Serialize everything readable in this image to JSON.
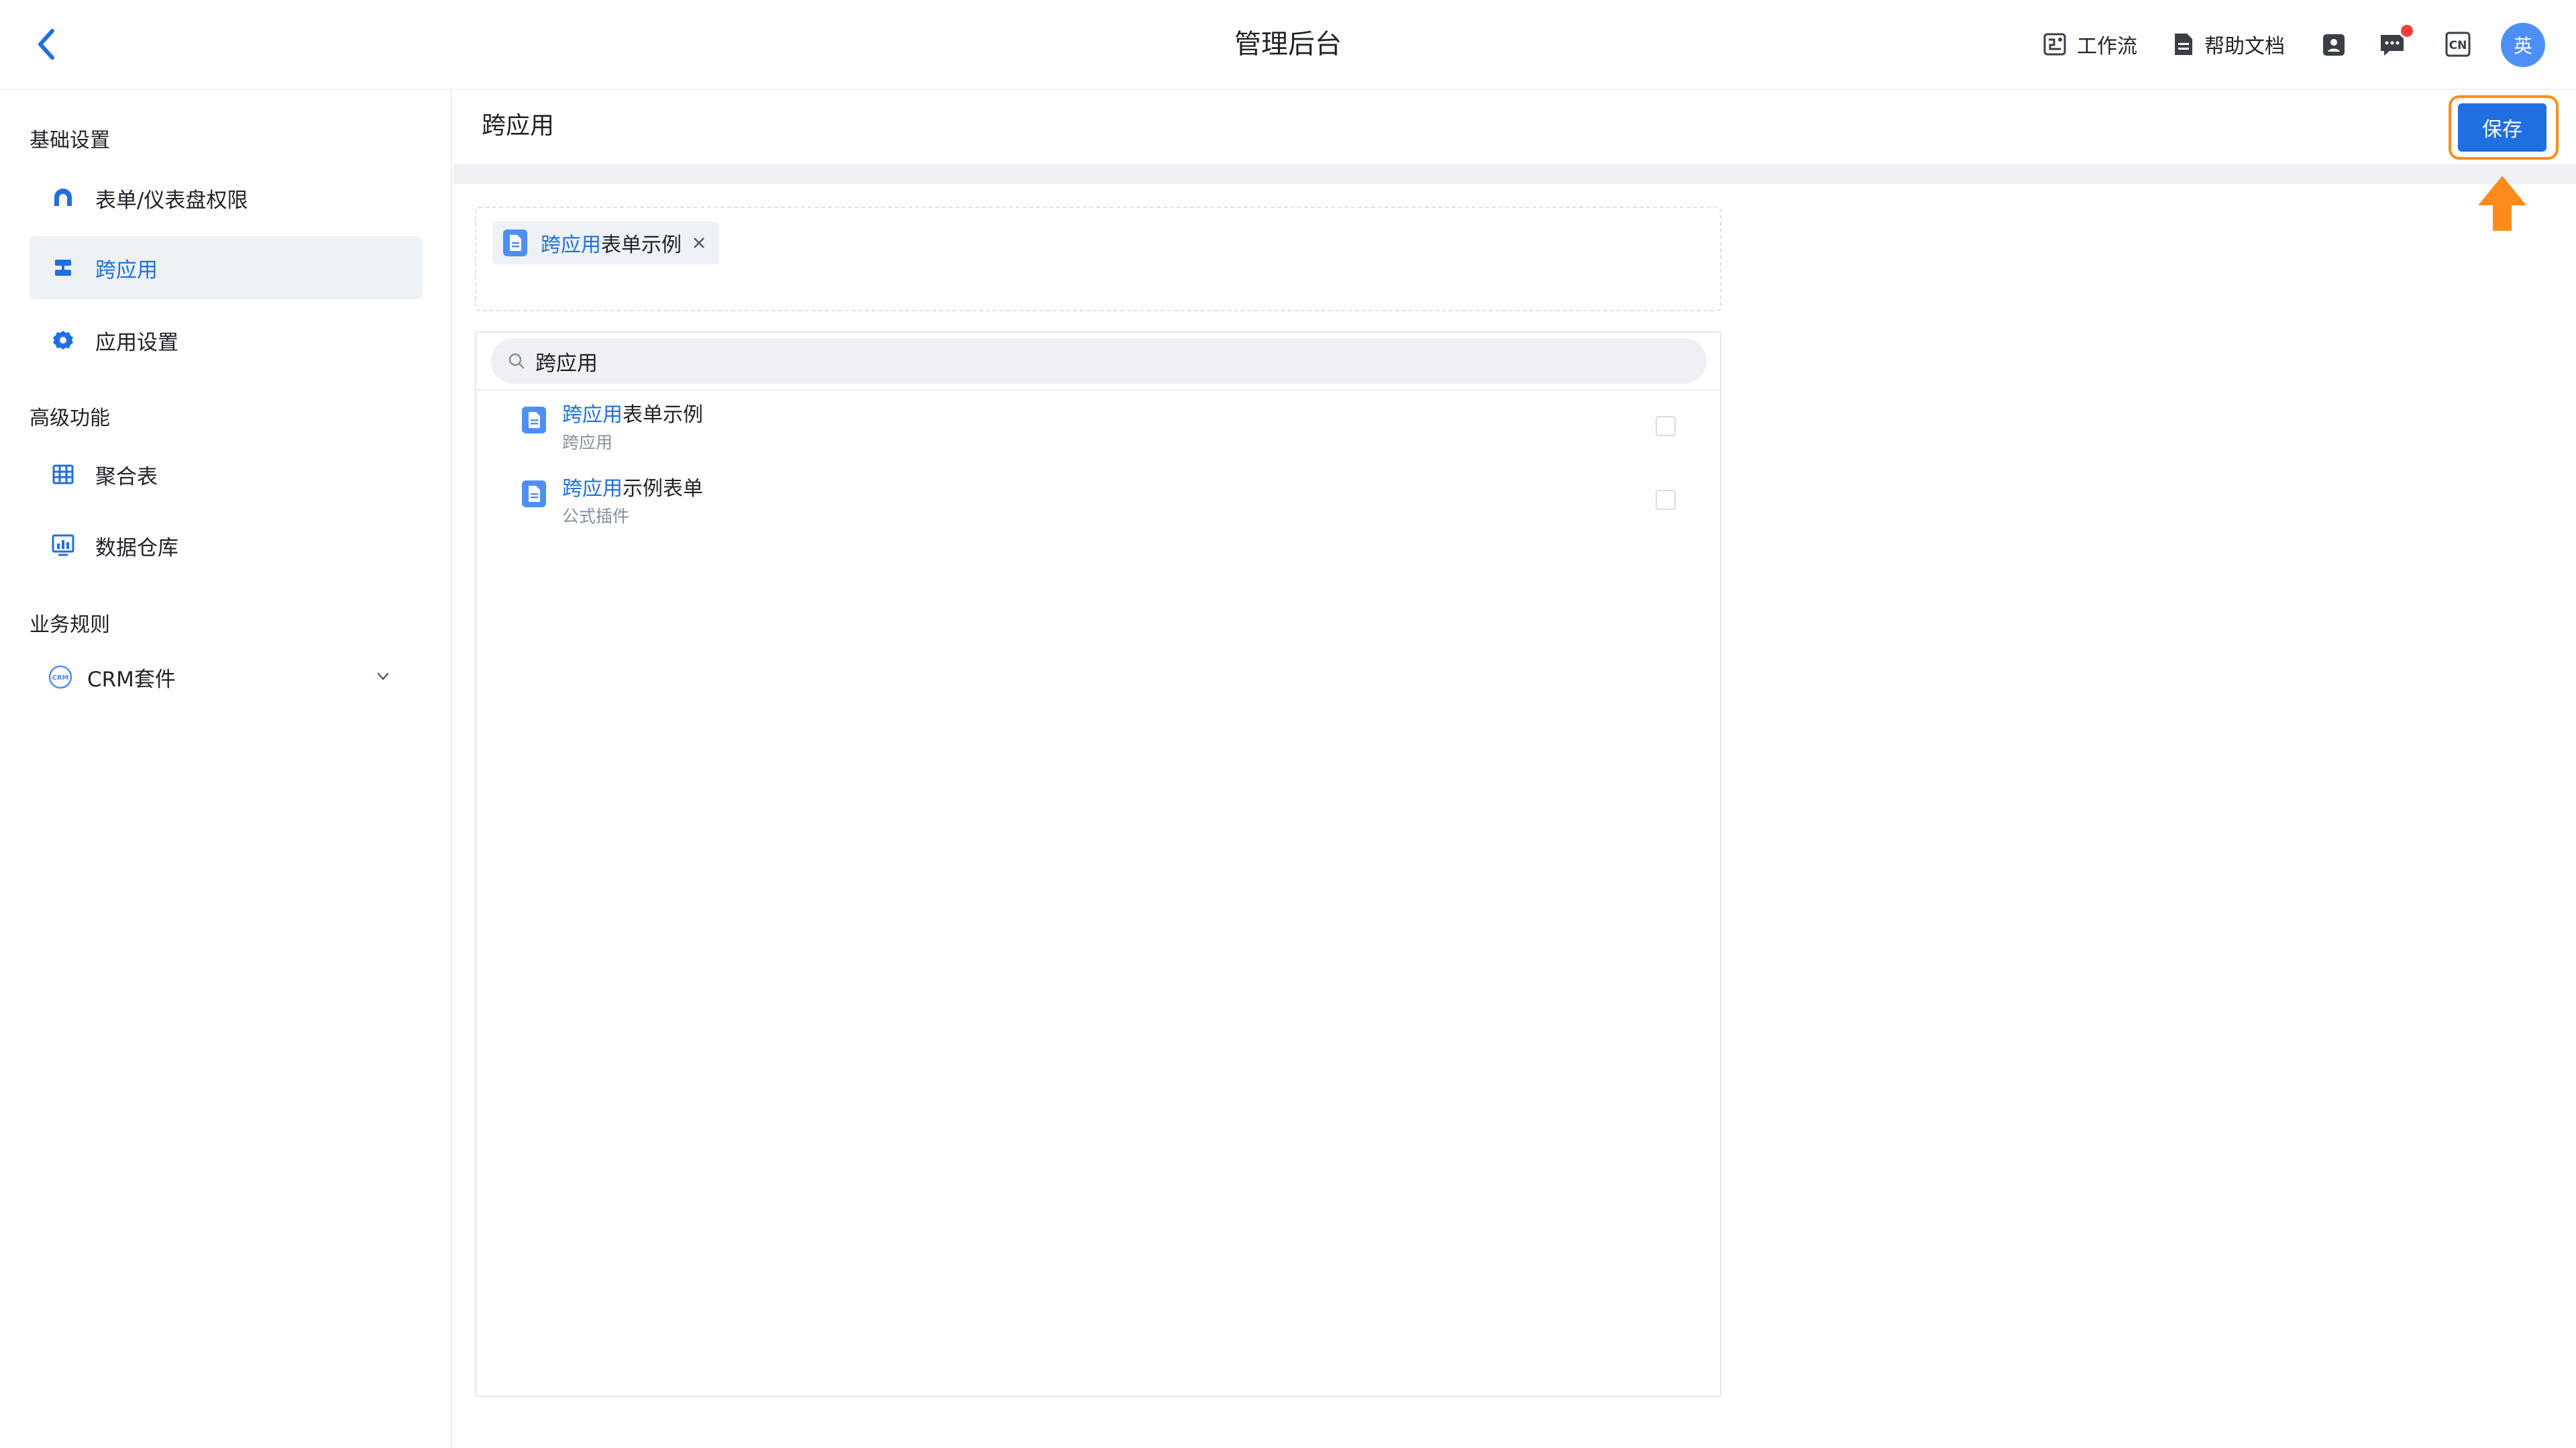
{
  "topbar": {
    "title": "管理后台",
    "actions": [
      {
        "label": "工作流",
        "icon": "workflow-icon"
      },
      {
        "label": "帮助文档",
        "icon": "document-icon"
      }
    ],
    "icons": [
      "contacts-icon",
      "message-icon",
      "language-icon"
    ],
    "language_icon_text": "CN",
    "avatar_text": "英"
  },
  "sidebar": {
    "groups": [
      {
        "label": "基础设置"
      },
      {
        "label": "高级功能"
      },
      {
        "label": "业务规则"
      }
    ],
    "items": [
      {
        "label": "表单/仪表盘权限",
        "icon": "permission-icon"
      },
      {
        "label": "跨应用",
        "icon": "cross-app-icon",
        "active": true
      },
      {
        "label": "应用设置",
        "icon": "gear-icon"
      },
      {
        "label": "聚合表",
        "icon": "table-grid-icon"
      },
      {
        "label": "数据仓库",
        "icon": "data-warehouse-icon"
      },
      {
        "label": "CRM套件",
        "icon": "crm-icon",
        "expandable": true
      }
    ]
  },
  "main": {
    "title": "跨应用",
    "save_label": "保存",
    "selected": [
      {
        "highlight": "跨应用",
        "rest": "表单示例"
      }
    ],
    "search": {
      "value": "跨应用",
      "placeholder": ""
    },
    "results": [
      {
        "highlight": "跨应用",
        "rest": "表单示例",
        "sub": "跨应用",
        "checked": false
      },
      {
        "highlight": "跨应用",
        "rest": "示例表单",
        "sub": "公式插件",
        "checked": false
      }
    ]
  },
  "colors": {
    "accent": "#1f6fe0",
    "highlight_border": "#ff8c1a",
    "notification": "#f53f3f",
    "avatar": "#4d8ff5"
  }
}
